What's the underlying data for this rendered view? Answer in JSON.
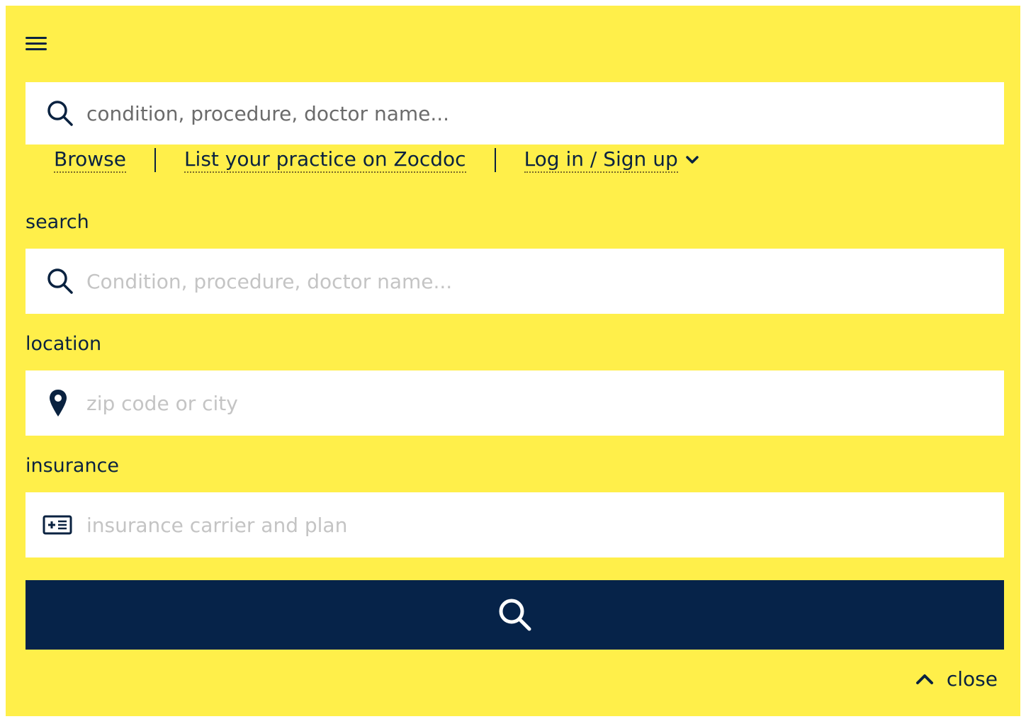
{
  "header": {
    "search_placeholder": "condition, procedure, doctor name..."
  },
  "nav": {
    "browse": "Browse",
    "list_practice": "List your practice on Zocdoc",
    "login": "Log in / Sign up"
  },
  "form": {
    "search_label": "search",
    "search_placeholder": "Condition, procedure, doctor name...",
    "location_label": "location",
    "location_placeholder": "zip code or city",
    "insurance_label": "insurance",
    "insurance_placeholder": "insurance carrier and plan"
  },
  "footer": {
    "close_label": "close"
  },
  "colors": {
    "background": "#ffef4a",
    "navy": "#062349",
    "field": "#ffffff"
  },
  "icons": [
    "menu-icon",
    "search-icon",
    "location-pin-icon",
    "insurance-card-icon",
    "chevron-down-icon",
    "chevron-up-icon"
  ]
}
